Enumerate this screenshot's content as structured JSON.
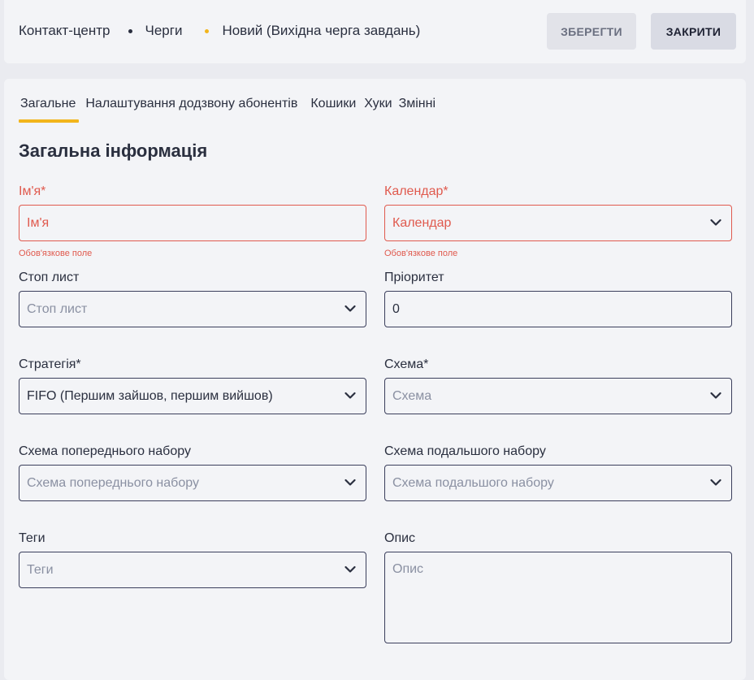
{
  "header": {
    "breadcrumb": [
      "Контакт-центр",
      "Черги",
      "Новий (Вихідна черга завдань)"
    ],
    "save_label": "ЗБЕРЕГТИ",
    "close_label": "ЗАКРИТИ"
  },
  "tabs": [
    "Загальне",
    "Налаштування додзвону абонентів",
    "Кошики",
    "Хуки",
    "Змінні"
  ],
  "section_title": "Загальна інформація",
  "fields": {
    "name": {
      "label": "Ім'я*",
      "placeholder": "Ім'я",
      "error": "Обов'язкове поле"
    },
    "calendar": {
      "label": "Календар*",
      "placeholder": "Календар",
      "error": "Обов'язкове поле"
    },
    "stoplist": {
      "label": "Стоп лист",
      "placeholder": "Стоп лист"
    },
    "priority": {
      "label": "Пріоритет",
      "value": "0"
    },
    "strategy": {
      "label": "Стратегія*",
      "value": "FIFO (Першим зайшов, першим вийшов)"
    },
    "scheme": {
      "label": "Схема*",
      "placeholder": "Схема"
    },
    "pre_scheme": {
      "label": "Схема попереднього набору",
      "placeholder": "Схема попереднього набору"
    },
    "post_scheme": {
      "label": "Схема подальшого набору",
      "placeholder": "Схема подальшого набору"
    },
    "tags": {
      "label": "Теги",
      "placeholder": "Теги"
    },
    "description": {
      "label": "Опис",
      "placeholder": "Опис"
    }
  },
  "colors": {
    "accent": "#f2b51c",
    "error": "#e05a4e",
    "border": "#3b3f5c"
  },
  "icons": {
    "dropdown": "chevron-down-icon"
  }
}
